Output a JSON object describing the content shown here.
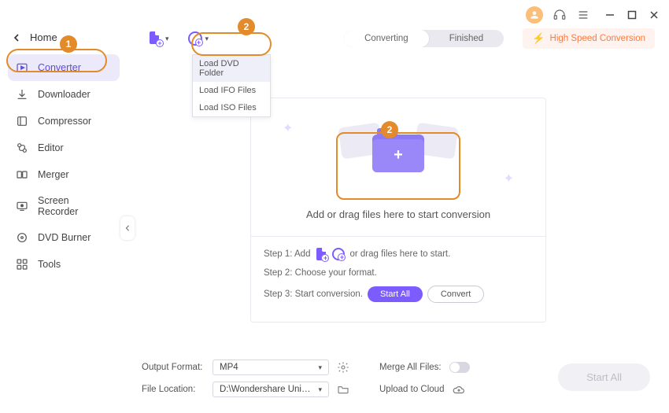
{
  "header": {
    "home_label": "Home"
  },
  "sidebar": {
    "items": [
      {
        "label": "Converter"
      },
      {
        "label": "Downloader"
      },
      {
        "label": "Compressor"
      },
      {
        "label": "Editor"
      },
      {
        "label": "Merger"
      },
      {
        "label": "Screen Recorder"
      },
      {
        "label": "DVD Burner"
      },
      {
        "label": "Tools"
      }
    ]
  },
  "tabs": {
    "converting": "Converting",
    "finished": "Finished"
  },
  "hsc": {
    "label": "High Speed Conversion"
  },
  "dvd_menu": {
    "items": [
      {
        "label": "Load DVD Folder"
      },
      {
        "label": "Load IFO Files"
      },
      {
        "label": "Load ISO Files"
      }
    ]
  },
  "drop": {
    "text": "Add or drag files here to start conversion"
  },
  "steps": {
    "s1_prefix": "Step 1: Add",
    "s1_suffix": "or drag files here to start.",
    "s2": "Step 2: Choose your format.",
    "s3": "Step 3: Start conversion.",
    "start_all": "Start All",
    "convert": "Convert"
  },
  "footer": {
    "output_format_label": "Output Format:",
    "output_format_value": "MP4",
    "merge_label": "Merge All Files:",
    "file_location_label": "File Location:",
    "file_location_value": "D:\\Wondershare UniConverter 1",
    "upload_label": "Upload to Cloud",
    "start_all": "Start All"
  },
  "callouts": {
    "one": "1",
    "two": "2"
  }
}
